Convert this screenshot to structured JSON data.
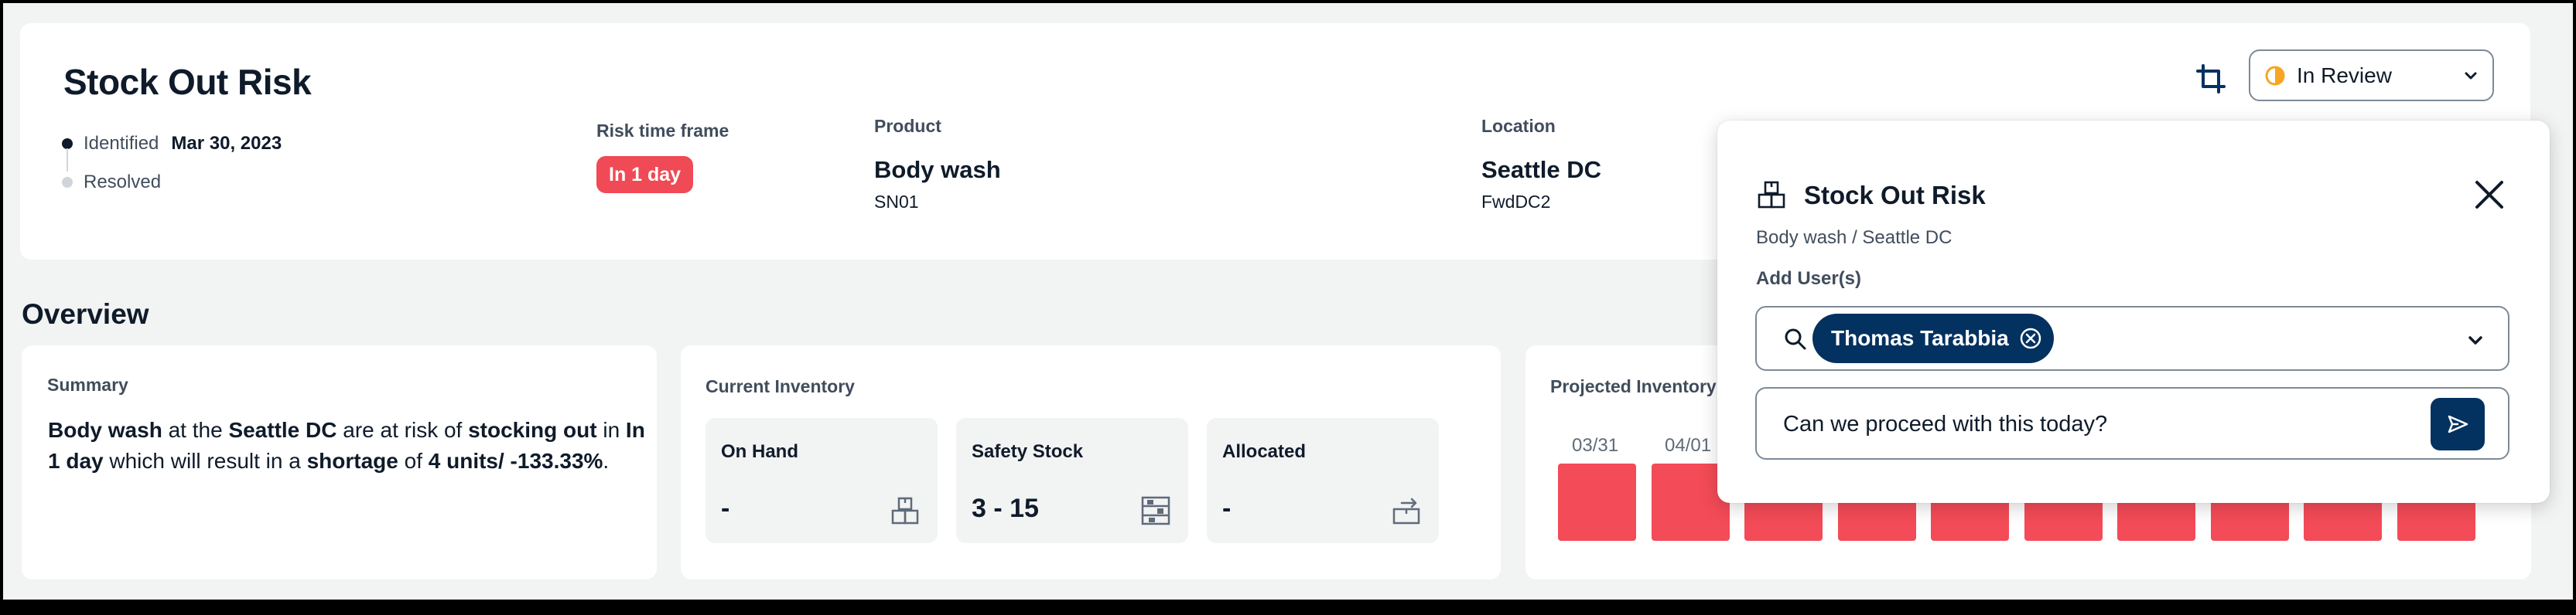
{
  "header": {
    "title": "Stock Out Risk",
    "timeline": [
      {
        "label": "Identified",
        "date": "Mar 30, 2023"
      },
      {
        "label": "Resolved",
        "date": ""
      }
    ],
    "risk_time_frame": {
      "label": "Risk time frame",
      "value": "In 1 day"
    },
    "product": {
      "label": "Product",
      "name": "Body wash",
      "code": "SN01"
    },
    "location": {
      "label": "Location",
      "name": "Seattle DC",
      "code": "FwdDC2"
    },
    "status": {
      "value": "In Review"
    }
  },
  "overview": {
    "title": "Overview",
    "summary": {
      "title": "Summary",
      "parts": {
        "p1": "Body wash",
        "p2": " at the ",
        "p3": "Seattle DC",
        "p4": " are at risk of ",
        "p5": "stocking out",
        "p6": " in ",
        "p7": "In 1 day",
        "p8": " which will result in a ",
        "p9": "shortage",
        "p10": " of ",
        "p11": "4 units/ -133.33%",
        "p12": "."
      }
    },
    "current_inventory": {
      "title": "Current Inventory",
      "tiles": [
        {
          "label": "On Hand",
          "value": "-",
          "icon": "box-stack-icon"
        },
        {
          "label": "Safety Stock",
          "value": "3 - 15",
          "icon": "warehouse-shelves-icon"
        },
        {
          "label": "Allocated",
          "value": "-",
          "icon": "box-transfer-icon"
        }
      ]
    },
    "projected_inventory": {
      "title": "Projected Inventory",
      "dates": [
        "03/31",
        "04/01"
      ],
      "bar_count": 10,
      "bar_color": "#f34b57"
    }
  },
  "popover": {
    "title": "Stock Out Risk",
    "breadcrumb": "Body wash / Seattle DC",
    "add_users_label": "Add User(s)",
    "selected_user": "Thomas Tarabbia",
    "message": "Can we proceed with this today?"
  },
  "colors": {
    "accent_dark": "#033160",
    "risk_red": "#ef4a56",
    "status_orange": "#f5a623"
  }
}
